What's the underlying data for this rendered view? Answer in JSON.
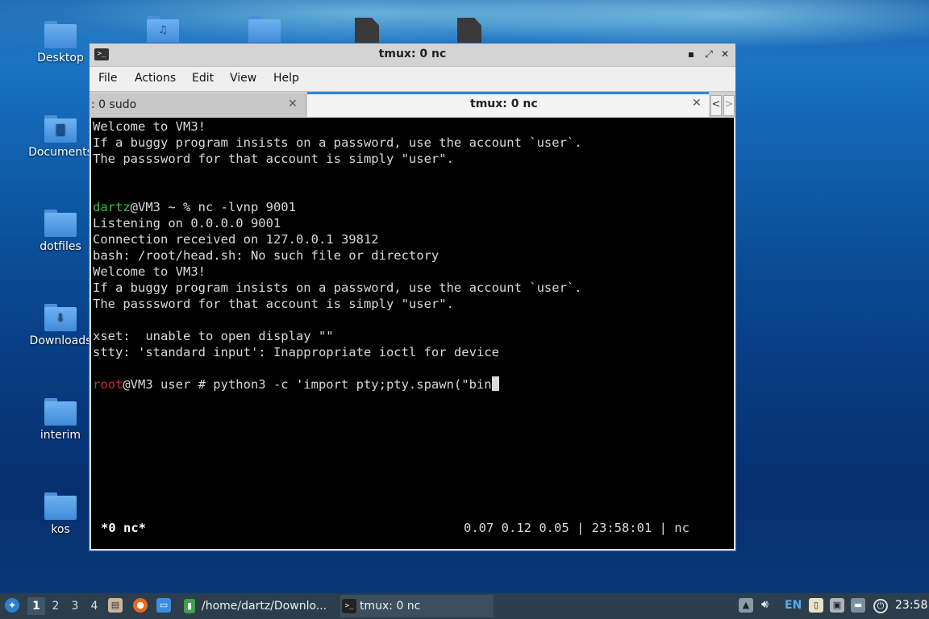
{
  "desktop": {
    "icons": [
      {
        "label": "Desktop"
      },
      {
        "label": "Documents"
      },
      {
        "label": "dotfiles"
      },
      {
        "label": "Downloads"
      },
      {
        "label": "interim"
      },
      {
        "label": "kos"
      }
    ]
  },
  "window": {
    "title": "tmux: 0 nc",
    "menu": [
      "File",
      "Actions",
      "Edit",
      "View",
      "Help"
    ],
    "tabs": [
      {
        "label": ": 0 sudo",
        "active": false
      },
      {
        "label": "tmux: 0 nc",
        "active": true
      }
    ]
  },
  "terminal": {
    "lines": [
      {
        "text": "Welcome to VM3!"
      },
      {
        "text": "If a buggy program insists on a password, use the account `user`."
      },
      {
        "text": "The passsword for that account is simply \"user\"."
      },
      {
        "text": ""
      },
      {
        "text": ""
      },
      {
        "user": "dartz",
        "rest": "@VM3 ~ % nc -lvnp 9001"
      },
      {
        "text": "Listening on 0.0.0.0 9001"
      },
      {
        "text": "Connection received on 127.0.0.1 39812"
      },
      {
        "text": "bash: /root/head.sh: No such file or directory"
      },
      {
        "text": "Welcome to VM3!"
      },
      {
        "text": "If a buggy program insists on a password, use the account `user`."
      },
      {
        "text": "The passsword for that account is simply \"user\"."
      },
      {
        "text": ""
      },
      {
        "text": "xset:  unable to open display \"\""
      },
      {
        "text": "stty: 'standard input': Inappropriate ioctl for device"
      },
      {
        "text": ""
      },
      {
        "root": "root",
        "rest": "@VM3 user # python3 -c 'import pty;pty.spawn(\"bin"
      }
    ],
    "status_left": "*0 nc*",
    "status_right": "0.07 0.12 0.05 | 23:58:01 | nc"
  },
  "taskbar": {
    "workspaces": [
      "1",
      "2",
      "3",
      "4"
    ],
    "active_workspace": "1",
    "tasks": [
      {
        "label": "/home/dartz/Downlo...",
        "icon": "file-manager-icon"
      },
      {
        "label": "tmux: 0 nc",
        "icon": "terminal-icon"
      }
    ],
    "keyboard_layout": "EN",
    "clock": "23:58"
  }
}
